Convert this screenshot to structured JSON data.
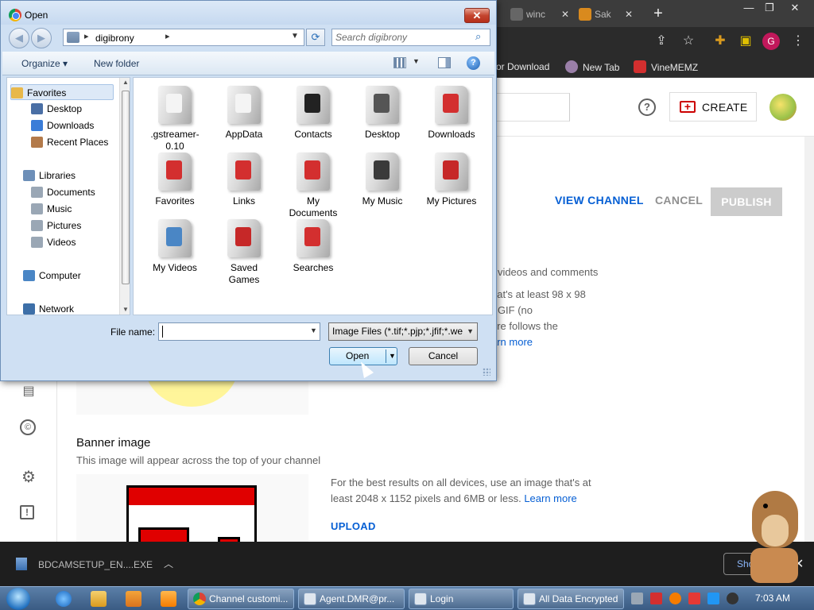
{
  "browser": {
    "tabs": [
      {
        "label": "winc",
        "close": "✕"
      },
      {
        "label": "Sak",
        "close": "✕"
      }
    ],
    "new_tab": "+",
    "window_controls": {
      "minimize": "—",
      "restore": "❐",
      "close": "✕"
    },
    "toolbar_icons": [
      "share-icon",
      "star-icon",
      "extensions-icon",
      "sidebar-icon"
    ],
    "profile_letter": "G",
    "menu_dots": "⋮",
    "bookmarks": [
      {
        "label": "or Download"
      },
      {
        "label": "New Tab"
      },
      {
        "label": "VineMEMZ"
      }
    ]
  },
  "studio": {
    "help_glyph": "?",
    "create_label": "CREATE",
    "view_channel": "VIEW CHANNEL",
    "cancel": "CANCEL",
    "publish": "PUBLISH",
    "profile_text_lines": [
      "r videos and comments",
      "hat's at least 98 x 98",
      "r GIF (no",
      "ure follows the"
    ],
    "learn_more_1": "arn more",
    "banner_title": "Banner image",
    "banner_subtitle": "This image will appear across the top of your channel",
    "banner_desc": "For the best results on all devices, use an image that's at least 2048 x 1152 pixels and 6MB or less.",
    "learn_more_2": "Learn more",
    "upload": "UPLOAD",
    "rail_icons": [
      "subtitles-icon",
      "copyright-icon",
      "settings-icon",
      "feedback-icon"
    ],
    "copyright_glyph": "©",
    "settings_glyph": "⚙",
    "feedback_glyph": "!"
  },
  "download_shelf": {
    "file": "BDCAMSETUP_EN....EXE",
    "show_all": "Sho",
    "close": "✕"
  },
  "dialog": {
    "title": "Open",
    "close": "✕",
    "breadcrumb": "digibrony",
    "search_placeholder": "Search digibrony",
    "organize": "Organize",
    "new_folder": "New folder",
    "help": "?",
    "nav": [
      {
        "label": "Favorites",
        "color": "#e8b84a"
      },
      {
        "label": "Desktop",
        "color": "#4a6fa5"
      },
      {
        "label": "Downloads",
        "color": "#3b7dd8"
      },
      {
        "label": "Recent Places",
        "color": "#b37a4a"
      },
      {
        "label": "Libraries",
        "color": "#6d8fb8"
      },
      {
        "label": "Documents",
        "color": "#9aa7b5"
      },
      {
        "label": "Music",
        "color": "#9aa7b5"
      },
      {
        "label": "Pictures",
        "color": "#9aa7b5"
      },
      {
        "label": "Videos",
        "color": "#9aa7b5"
      },
      {
        "label": "Computer",
        "color": "#4a86c5"
      },
      {
        "label": "Network",
        "color": "#3d6fa8"
      }
    ],
    "files": [
      {
        "label": ".gstreamer-\n0.10",
        "accent": "#f4f4f4"
      },
      {
        "label": "AppData",
        "accent": "#f4f4f4"
      },
      {
        "label": "Contacts",
        "accent": "#222222"
      },
      {
        "label": "Desktop",
        "accent": "#555555"
      },
      {
        "label": "Downloads",
        "accent": "#d32f2f"
      },
      {
        "label": "Favorites",
        "accent": "#d32f2f"
      },
      {
        "label": "Links",
        "accent": "#d32f2f"
      },
      {
        "label": "My\nDocuments",
        "accent": "#d32f2f"
      },
      {
        "label": "My Music",
        "accent": "#3a3a3a"
      },
      {
        "label": "My Pictures",
        "accent": "#c62828"
      },
      {
        "label": "My Videos",
        "accent": "#4a86c5"
      },
      {
        "label": "Saved\nGames",
        "accent": "#c62828"
      },
      {
        "label": "Searches",
        "accent": "#d32f2f"
      }
    ],
    "filename_label": "File name:",
    "filename_value": "",
    "filetype": "Image Files (*.tif;*.pjp;*.jfif;*.we",
    "open": "Open",
    "cancel": "Cancel"
  },
  "taskbar": {
    "tasks": [
      {
        "label": "Channel customi..."
      },
      {
        "label": "Agent.DMR@pr..."
      },
      {
        "label": "Login"
      },
      {
        "label": "All Data Encrypted"
      }
    ],
    "clock": "7:03 AM"
  }
}
